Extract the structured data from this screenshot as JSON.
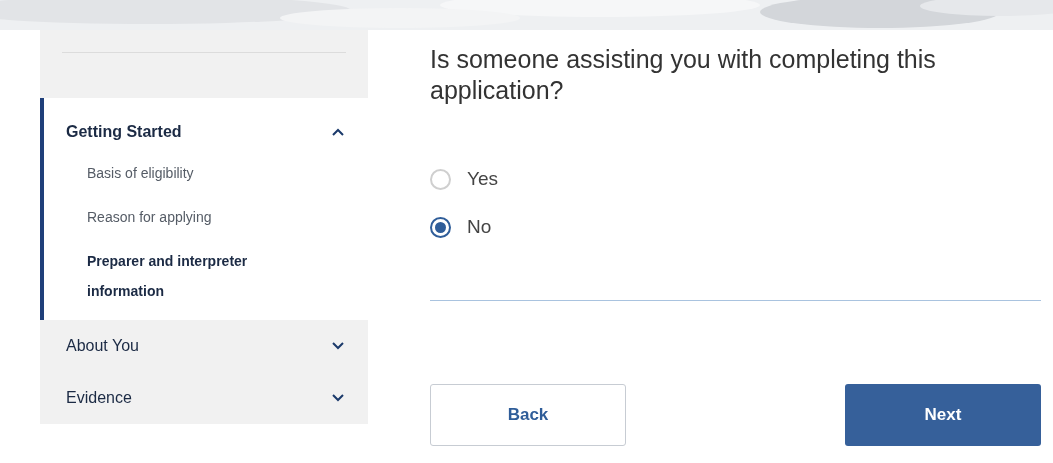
{
  "sidebar": {
    "sections": [
      {
        "label": "Getting Started",
        "expanded": true,
        "children": [
          {
            "label": "Basis of eligibility",
            "selected": false
          },
          {
            "label": "Reason for applying",
            "selected": false
          },
          {
            "label": "Preparer and interpreter information",
            "selected": true
          }
        ]
      },
      {
        "label": "About You",
        "expanded": false
      },
      {
        "label": "Evidence",
        "expanded": false
      }
    ]
  },
  "question": "Is someone assisting you with completing this application?",
  "options": [
    {
      "label": "Yes",
      "selected": false
    },
    {
      "label": "No",
      "selected": true
    }
  ],
  "buttons": [
    {
      "label": "Back",
      "kind": "secondary"
    },
    {
      "label": "Next",
      "kind": "primary"
    }
  ]
}
